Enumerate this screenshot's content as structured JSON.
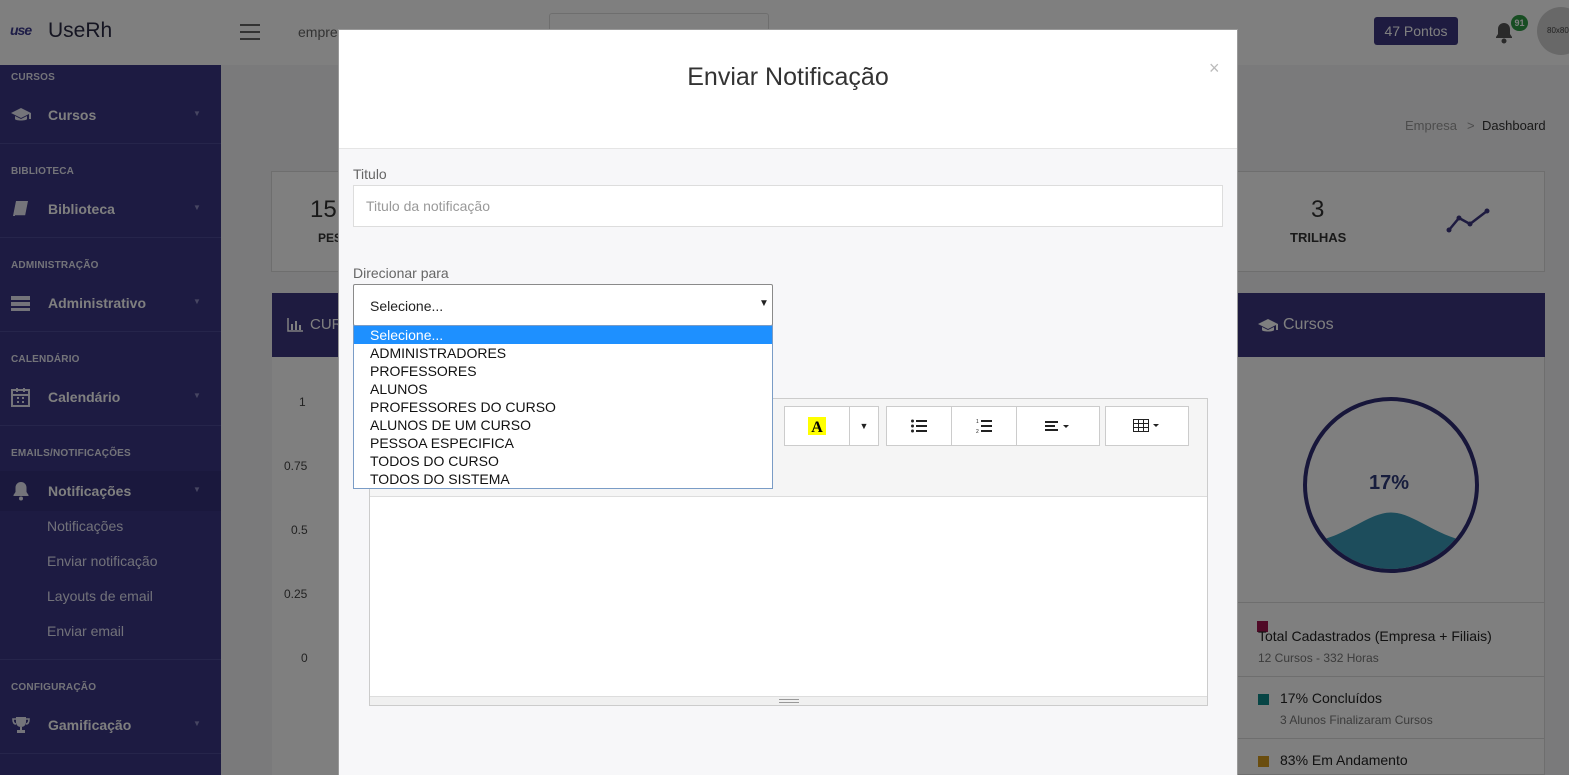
{
  "topbar": {
    "logo_mark": "use",
    "logo_text": "UseRh",
    "company_crumb": "empre",
    "points_label": "47 Pontos",
    "notification_count": "91",
    "avatar_text": "80x80"
  },
  "sidebar": {
    "sections": [
      {
        "title": "CURSOS",
        "item": "Cursos",
        "icon": "graduation-cap-icon"
      },
      {
        "title": "BIBLIOTECA",
        "item": "Biblioteca",
        "icon": "book-icon"
      },
      {
        "title": "ADMINISTRAÇÃO",
        "item": "Administrativo",
        "icon": "server-icon"
      },
      {
        "title": "CALENDÁRIO",
        "item": "Calendário",
        "icon": "calendar-icon"
      },
      {
        "title": "EMAILS/NOTIFICAÇÕES",
        "item": "Notificações",
        "icon": "bell-icon"
      },
      {
        "title": "CONFIGURAÇÃO",
        "item": "Gamificação",
        "icon": "trophy-icon"
      }
    ],
    "sub_items": [
      "Notificações",
      "Enviar notificação",
      "Layouts de email",
      "Enviar email"
    ]
  },
  "main": {
    "breadcrumb": {
      "parent": "Empresa",
      "separator": ">",
      "current": "Dashboard"
    },
    "stat_left": {
      "value": "15",
      "label": "PES"
    },
    "stat_trilhas": {
      "value": "3",
      "label": "TRILHAS"
    },
    "chart_panel_title": "CUR",
    "y_ticks": [
      "1",
      "0.75",
      "0.5",
      "0.25",
      "0"
    ],
    "courses_panel_title": "Cursos",
    "gauge_percent": "17%",
    "gauge_fill_fraction": 0.17,
    "legend": [
      {
        "title": "Total Cadastrados (Empresa + Filiais)",
        "sub": "12 Cursos - 332 Horas",
        "color": "#a0154f"
      },
      {
        "title": "17% Concluídos",
        "sub": "3 Alunos Finalizaram Cursos",
        "color": "#0f8a8a"
      },
      {
        "title": "83% Em Andamento",
        "sub": "",
        "color": "#d49a1c"
      }
    ]
  },
  "modal": {
    "title": "Enviar Notificação",
    "close_label": "×",
    "titulo_label": "Titulo",
    "titulo_placeholder": "Titulo da notificação",
    "direcionar_label": "Direcionar para",
    "select_value": "Selecione...",
    "options": [
      "Selecione...",
      "ADMINISTRADORES",
      "PROFESSORES",
      "ALUNOS",
      "PROFESSORES DO CURSO",
      "ALUNOS DE UM CURSO",
      "PESSOA ESPECIFICA",
      "TODOS DO CURSO",
      "TODOS DO SISTEMA"
    ],
    "selected_option_index": 0,
    "toolbar_buttons": [
      "font-color-icon",
      "dropdown-caret-icon",
      "unordered-list-icon",
      "ordered-list-icon",
      "align-icon",
      "table-icon"
    ]
  },
  "colors": {
    "sidebar_bg": "#3a3784",
    "accent": "#3d3780",
    "badge_green": "#2e9b45",
    "dropdown_selected": "#1e90ff"
  }
}
